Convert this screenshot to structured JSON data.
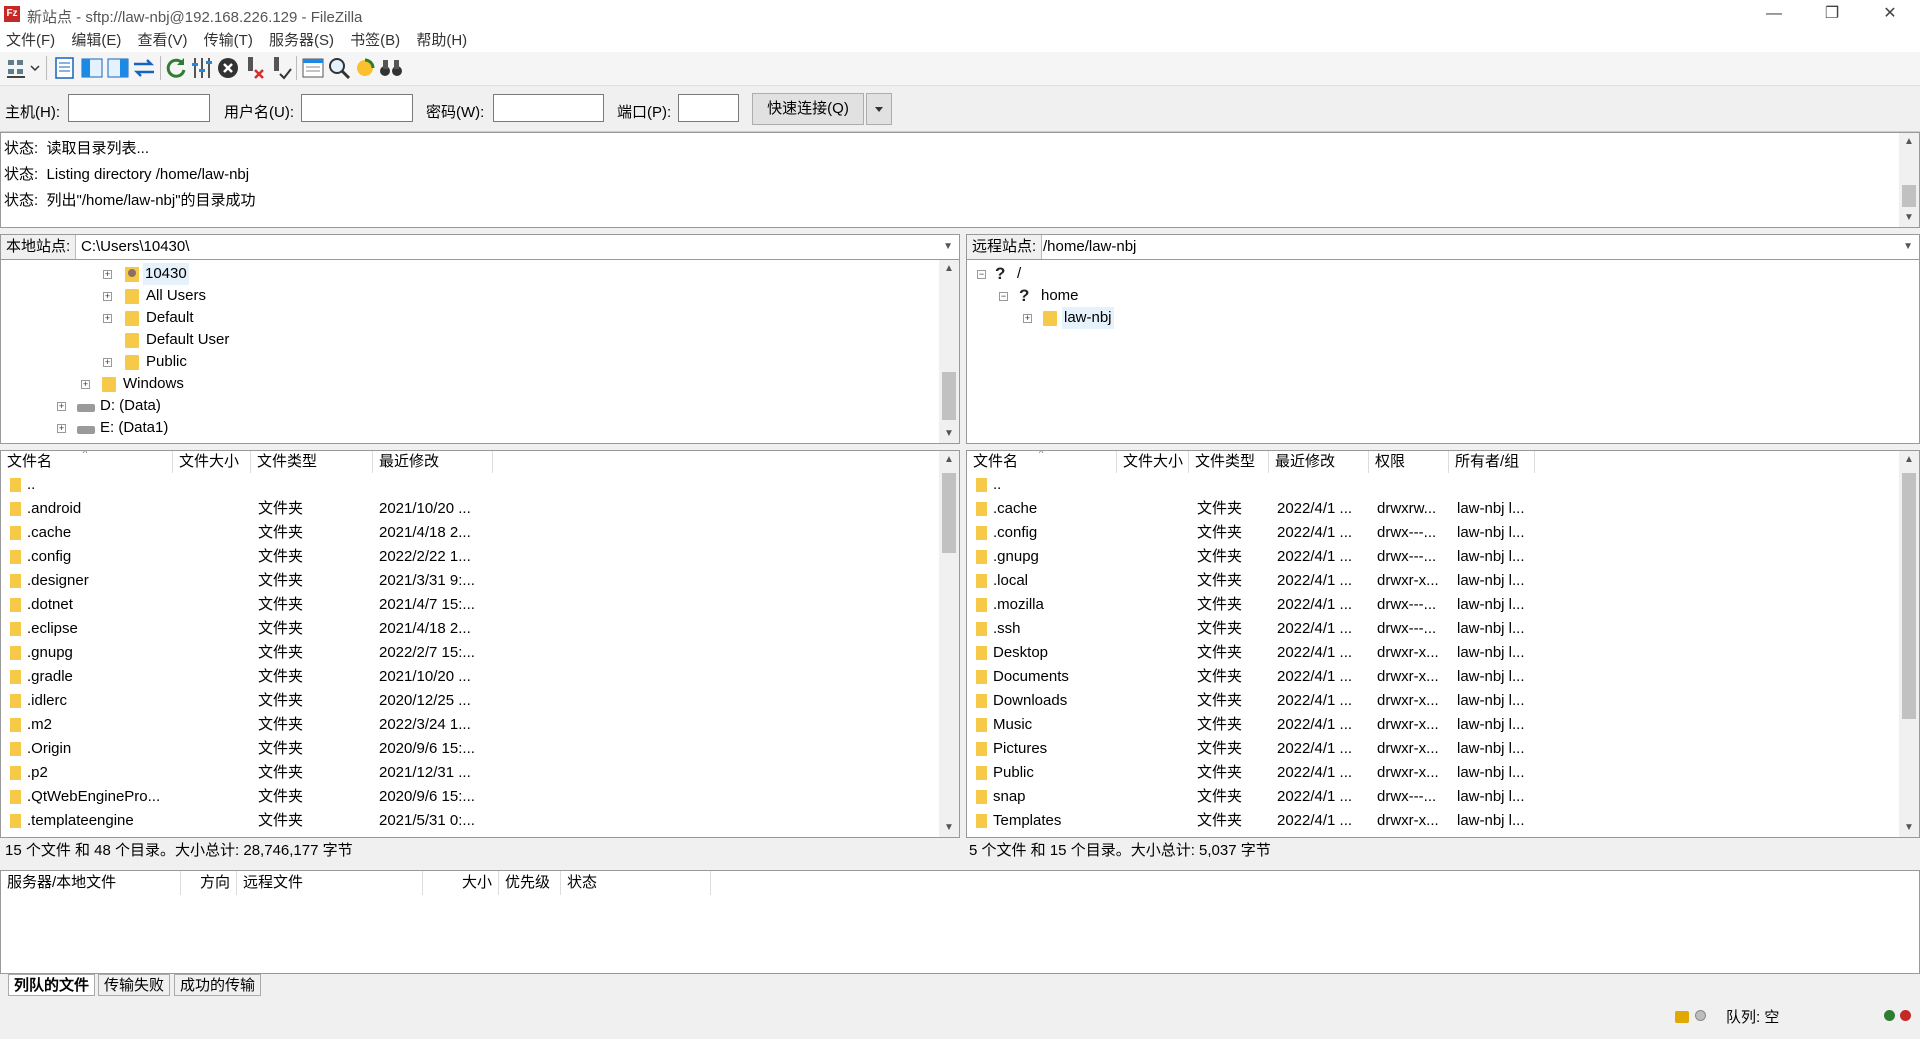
{
  "window": {
    "title": "新站点 - sftp://law-nbj@192.168.226.129 - FileZilla",
    "app_icon_text": "Fz",
    "minimize": "—",
    "restore": "❐",
    "close": "✕"
  },
  "menu": [
    "文件(F)",
    "编辑(E)",
    "查看(V)",
    "传输(T)",
    "服务器(S)",
    "书签(B)",
    "帮助(H)"
  ],
  "quickconnect": {
    "host_label": "主机(H):",
    "user_label": "用户名(U):",
    "pass_label": "密码(W):",
    "port_label": "端口(P):",
    "host_value": "",
    "user_value": "",
    "pass_value": "",
    "port_value": "",
    "connect_button": "快速连接(Q)"
  },
  "log": [
    {
      "label": "状态:",
      "text": "读取目录列表..."
    },
    {
      "label": "状态:",
      "text": "Listing directory /home/law-nbj"
    },
    {
      "label": "状态:",
      "text": "列出\"/home/law-nbj\"的目录成功"
    }
  ],
  "local": {
    "site_label": "本地站点:",
    "path": "C:\\Users\\10430\\",
    "tree": [
      "10430",
      "All Users",
      "Default",
      "Default User",
      "Public",
      "Windows",
      "D: (Data)",
      "E: (Data1)"
    ],
    "columns": [
      "文件名",
      "文件大小",
      "文件类型",
      "最近修改"
    ],
    "files": [
      {
        "name": "..",
        "size": "",
        "type": "",
        "modified": ""
      },
      {
        "name": ".android",
        "size": "",
        "type": "文件夹",
        "modified": "2021/10/20 ..."
      },
      {
        "name": ".cache",
        "size": "",
        "type": "文件夹",
        "modified": "2021/4/18 2..."
      },
      {
        "name": ".config",
        "size": "",
        "type": "文件夹",
        "modified": "2022/2/22 1..."
      },
      {
        "name": ".designer",
        "size": "",
        "type": "文件夹",
        "modified": "2021/3/31 9:..."
      },
      {
        "name": ".dotnet",
        "size": "",
        "type": "文件夹",
        "modified": "2021/4/7 15:..."
      },
      {
        "name": ".eclipse",
        "size": "",
        "type": "文件夹",
        "modified": "2021/4/18 2..."
      },
      {
        "name": ".gnupg",
        "size": "",
        "type": "文件夹",
        "modified": "2022/2/7 15:..."
      },
      {
        "name": ".gradle",
        "size": "",
        "type": "文件夹",
        "modified": "2021/10/20 ..."
      },
      {
        "name": ".idlerc",
        "size": "",
        "type": "文件夹",
        "modified": "2020/12/25 ..."
      },
      {
        "name": ".m2",
        "size": "",
        "type": "文件夹",
        "modified": "2022/3/24 1..."
      },
      {
        "name": ".Origin",
        "size": "",
        "type": "文件夹",
        "modified": "2020/9/6 15:..."
      },
      {
        "name": ".p2",
        "size": "",
        "type": "文件夹",
        "modified": "2021/12/31 ..."
      },
      {
        "name": ".QtWebEnginePro...",
        "size": "",
        "type": "文件夹",
        "modified": "2020/9/6 15:..."
      },
      {
        "name": ".templateengine",
        "size": "",
        "type": "文件夹",
        "modified": "2021/5/31 0:..."
      }
    ],
    "summary": "15 个文件 和 48 个目录。大小总计: 28,746,177 字节"
  },
  "remote": {
    "site_label": "远程站点:",
    "path": "/home/law-nbj",
    "tree": [
      "/",
      "home",
      "law-nbj"
    ],
    "columns": [
      "文件名",
      "文件大小",
      "文件类型",
      "最近修改",
      "权限",
      "所有者/组"
    ],
    "files": [
      {
        "name": "..",
        "type": "",
        "modified": "",
        "perm": "",
        "owner": ""
      },
      {
        "name": ".cache",
        "type": "文件夹",
        "modified": "2022/4/1 ...",
        "perm": "drwxrw...",
        "owner": "law-nbj l..."
      },
      {
        "name": ".config",
        "type": "文件夹",
        "modified": "2022/4/1 ...",
        "perm": "drwx---...",
        "owner": "law-nbj l..."
      },
      {
        "name": ".gnupg",
        "type": "文件夹",
        "modified": "2022/4/1 ...",
        "perm": "drwx---...",
        "owner": "law-nbj l..."
      },
      {
        "name": ".local",
        "type": "文件夹",
        "modified": "2022/4/1 ...",
        "perm": "drwxr-x...",
        "owner": "law-nbj l..."
      },
      {
        "name": ".mozilla",
        "type": "文件夹",
        "modified": "2022/4/1 ...",
        "perm": "drwx---...",
        "owner": "law-nbj l..."
      },
      {
        "name": ".ssh",
        "type": "文件夹",
        "modified": "2022/4/1 ...",
        "perm": "drwx---...",
        "owner": "law-nbj l..."
      },
      {
        "name": "Desktop",
        "type": "文件夹",
        "modified": "2022/4/1 ...",
        "perm": "drwxr-x...",
        "owner": "law-nbj l..."
      },
      {
        "name": "Documents",
        "type": "文件夹",
        "modified": "2022/4/1 ...",
        "perm": "drwxr-x...",
        "owner": "law-nbj l..."
      },
      {
        "name": "Downloads",
        "type": "文件夹",
        "modified": "2022/4/1 ...",
        "perm": "drwxr-x...",
        "owner": "law-nbj l..."
      },
      {
        "name": "Music",
        "type": "文件夹",
        "modified": "2022/4/1 ...",
        "perm": "drwxr-x...",
        "owner": "law-nbj l..."
      },
      {
        "name": "Pictures",
        "type": "文件夹",
        "modified": "2022/4/1 ...",
        "perm": "drwxr-x...",
        "owner": "law-nbj l..."
      },
      {
        "name": "Public",
        "type": "文件夹",
        "modified": "2022/4/1 ...",
        "perm": "drwxr-x...",
        "owner": "law-nbj l..."
      },
      {
        "name": "snap",
        "type": "文件夹",
        "modified": "2022/4/1 ...",
        "perm": "drwx---...",
        "owner": "law-nbj l..."
      },
      {
        "name": "Templates",
        "type": "文件夹",
        "modified": "2022/4/1 ...",
        "perm": "drwxr-x...",
        "owner": "law-nbj l..."
      }
    ],
    "summary": "5 个文件 和 15 个目录。大小总计: 5,037 字节"
  },
  "queue": {
    "columns": [
      "服务器/本地文件",
      "方向",
      "远程文件",
      "大小",
      "优先级",
      "状态"
    ]
  },
  "tabs": [
    "列队的文件",
    "传输失败",
    "成功的传输"
  ],
  "statusbar": {
    "queue": "队列: 空"
  },
  "colors": {
    "folder": "#f7c948",
    "accent_blue": "#1e88e5",
    "green_dot": "#2e7d32",
    "red_dot": "#c62828"
  }
}
